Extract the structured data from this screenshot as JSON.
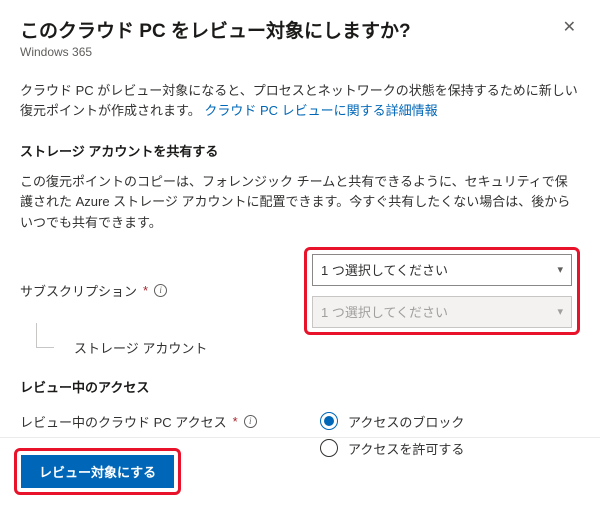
{
  "header": {
    "title": "このクラウド PC をレビュー対象にしますか?",
    "subtitle": "Windows 365"
  },
  "intro": {
    "text_before_link": "クラウド PC がレビュー対象になると、プロセスとネットワークの状態を保持するために新しい復元ポイントが作成されます。",
    "link_text": "クラウド PC レビューに関する詳細情報"
  },
  "storage_section": {
    "title": "ストレージ アカウントを共有する",
    "desc": "この復元ポイントのコピーは、フォレンジック チームと共有できるように、セキュリティで保護された Azure ストレージ アカウントに配置できます。今すぐ共有したくない場合は、後からいつでも共有できます。",
    "subscription_label": "サブスクリプション",
    "storage_account_label": "ストレージ アカウント",
    "subscription_placeholder": "1 つ選択してください",
    "storage_placeholder": "1 つ選択してください"
  },
  "access_section": {
    "title": "レビュー中のアクセス",
    "access_label": "レビュー中のクラウド PC アクセス",
    "option_block": "アクセスのブロック",
    "option_allow": "アクセスを許可する",
    "selected": "block"
  },
  "footer": {
    "primary_button": "レビュー対象にする"
  },
  "required_mark": "*"
}
